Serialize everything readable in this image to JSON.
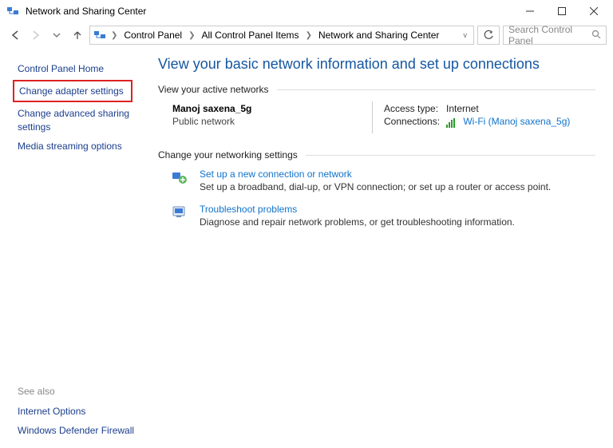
{
  "window": {
    "title": "Network and Sharing Center"
  },
  "breadcrumbs": {
    "b1": "Control Panel",
    "b2": "All Control Panel Items",
    "b3": "Network and Sharing Center"
  },
  "search": {
    "placeholder": "Search Control Panel"
  },
  "sidebar": {
    "home": "Control Panel Home",
    "adapter": "Change adapter settings",
    "advanced": "Change advanced sharing settings",
    "media": "Media streaming options",
    "see_also_label": "See also",
    "internet_options": "Internet Options",
    "firewall": "Windows Defender Firewall"
  },
  "main": {
    "page_title": "View your basic network information and set up connections",
    "active_label": "View your active networks",
    "network": {
      "name": "Manoj saxena_5g",
      "type": "Public network",
      "access_label": "Access type:",
      "access_value": "Internet",
      "conn_label": "Connections:",
      "conn_value": "Wi-Fi (Manoj saxena_5g)"
    },
    "change_label": "Change your networking settings",
    "task1": {
      "title": "Set up a new connection or network",
      "desc": "Set up a broadband, dial-up, or VPN connection; or set up a router or access point."
    },
    "task2": {
      "title": "Troubleshoot problems",
      "desc": "Diagnose and repair network problems, or get troubleshooting information."
    }
  }
}
